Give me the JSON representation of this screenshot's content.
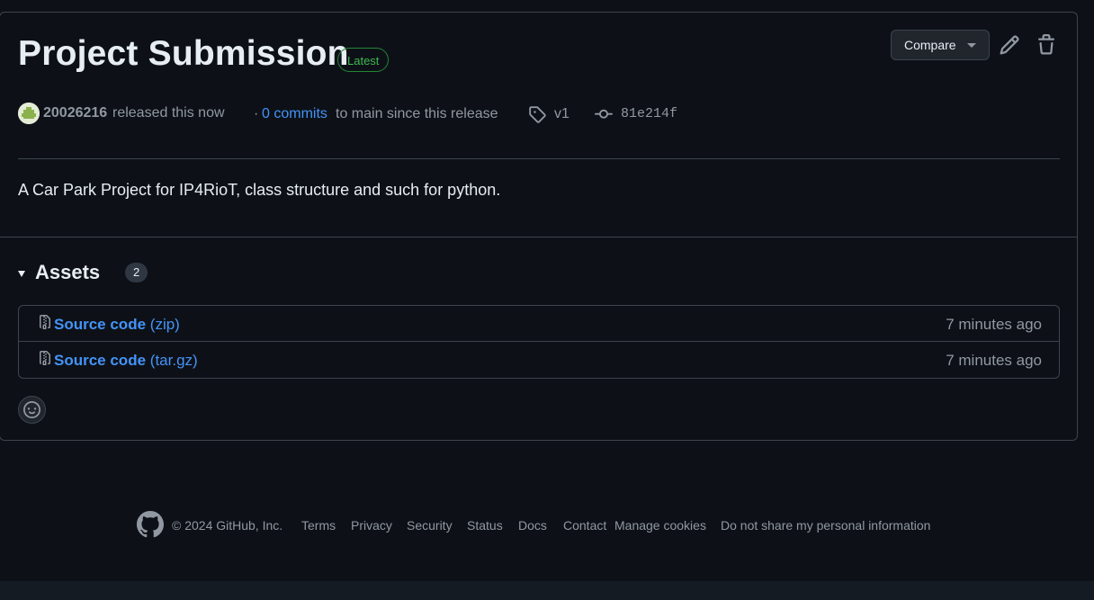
{
  "release": {
    "title": "Project Submission",
    "badge": "Latest",
    "compare_label": "Compare",
    "author": "20026216",
    "released_text": "released this now",
    "commits_prefix": "·",
    "commits_link": "0 commits",
    "commits_suffix": "to main since this release",
    "tag": "v1",
    "commit_hash": "81e214f",
    "description": "A Car Park Project for IP4RioT, class structure and such for python."
  },
  "assets": {
    "title": "Assets",
    "count": "2",
    "items": [
      {
        "name": "Source code",
        "ext": "(zip)",
        "time": "7 minutes ago"
      },
      {
        "name": "Source code",
        "ext": "(tar.gz)",
        "time": "7 minutes ago"
      }
    ]
  },
  "footer": {
    "copyright": "© 2024 GitHub, Inc.",
    "links": [
      "Terms",
      "Privacy",
      "Security",
      "Status",
      "Docs",
      "Contact",
      "Manage cookies",
      "Do not share my personal information"
    ]
  },
  "icons": {
    "edit": "pencil-icon",
    "delete": "trash-icon",
    "tag": "tag-icon",
    "commit": "git-commit-icon",
    "file": "file-zip-icon",
    "reaction": "smiley-icon",
    "logo": "github-mark-icon"
  },
  "colors": {
    "background": "#0d1117",
    "link": "#4493f8",
    "badge_green": "#3fb950",
    "muted": "#9198a1"
  }
}
